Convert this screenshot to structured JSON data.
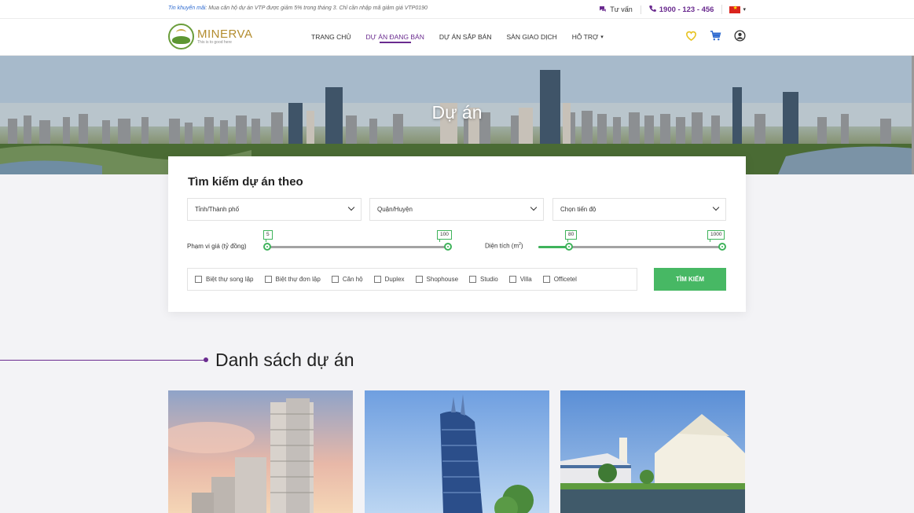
{
  "topbar": {
    "promo_label": "Tin khuyến mãi",
    "promo_text": ": Mua căn hộ dự án VTP được giảm 5% trong tháng 3. Chỉ cần nhập mã giảm giá VTP0190",
    "consult_label": "Tư vấn",
    "phone": "1900 - 123 - 456"
  },
  "nav": {
    "logo_name": "MINERVA",
    "logo_tagline": "This is to good here",
    "menu": [
      {
        "label": "TRANG CHỦ"
      },
      {
        "label": "DỰ ÁN ĐANG BÁN",
        "active": true
      },
      {
        "label": "DỰ ÁN SẮP BÁN"
      },
      {
        "label": "SÀN GIAO DỊCH"
      },
      {
        "label": "HỖ TRỢ"
      }
    ]
  },
  "banner": {
    "title": "Dự án"
  },
  "search": {
    "title": "Tìm kiếm dự án theo",
    "city_placeholder": "Tỉnh/Thành phố",
    "district_placeholder": "Quận/Huyện",
    "progress_placeholder": "Chọn tiến độ",
    "price_label": "Phạm vi giá (tỷ đồng)",
    "price_min": "5",
    "price_max": "100",
    "area_label_prefix": "Diện tích (m",
    "area_label_sup": "2",
    "area_label_suffix": ")",
    "area_min": "80",
    "area_max": "1000",
    "types": [
      "Biệt thự song lập",
      "Biệt thự đơn lập",
      "Căn hộ",
      "Duplex",
      "Shophouse",
      "Studio",
      "Villa",
      "Officetel"
    ],
    "button_label": "TÌM KIẾM"
  },
  "list": {
    "title": "Danh sách dự án"
  },
  "colors": {
    "brand_purple": "#6a2b8f",
    "accent_green": "#47b864",
    "logo_gold": "#b38c2e"
  },
  "icons": [
    "chat-icon",
    "phone-icon",
    "vietnam-flag-icon",
    "heart-icon",
    "cart-icon",
    "user-icon"
  ]
}
